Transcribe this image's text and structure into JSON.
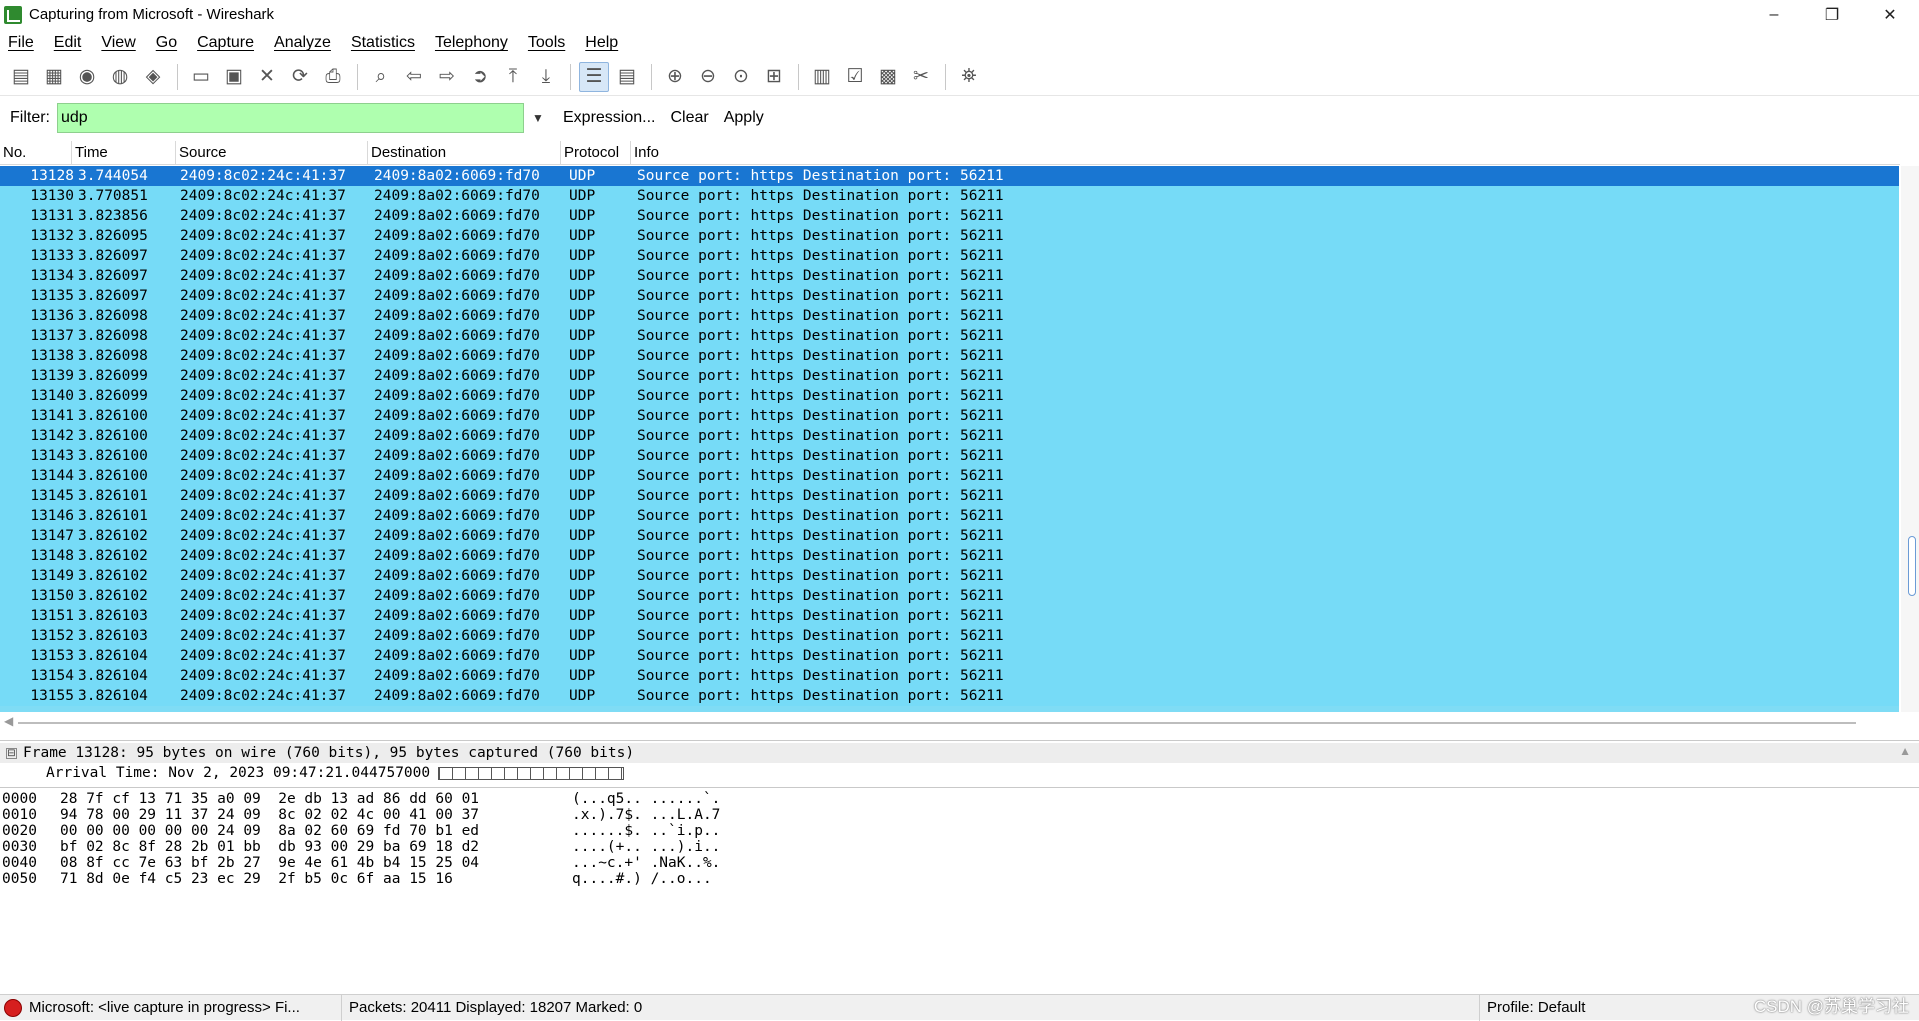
{
  "window": {
    "title": "Capturing from Microsoft - Wireshark",
    "minimize": "–",
    "restore": "❐",
    "close": "✕"
  },
  "menu": [
    "File",
    "Edit",
    "View",
    "Go",
    "Capture",
    "Analyze",
    "Statistics",
    "Telephony",
    "Tools",
    "Help"
  ],
  "toolbar": {
    "groups": [
      [
        "interfaces-icon",
        "options-icon",
        "start-icon",
        "stop-icon",
        "restart-icon"
      ],
      [
        "open-icon",
        "save-icon",
        "close-icon",
        "reload-icon",
        "print-icon"
      ],
      [
        "find-icon",
        "back-icon",
        "forward-icon",
        "goto-icon",
        "first-icon",
        "last-icon"
      ],
      [
        "colorize-icon",
        "autoscroll-icon"
      ],
      [
        "zoom-in-icon",
        "zoom-out-icon",
        "zoom-normal-icon",
        "resize-columns-icon"
      ],
      [
        "capture-filters-icon",
        "display-filters-icon",
        "coloring-rules-icon",
        "preferences-icon"
      ],
      [
        "help-icon"
      ]
    ],
    "glyphs": {
      "interfaces-icon": "▤",
      "options-icon": "▦",
      "start-icon": "◉",
      "stop-icon": "◍",
      "restart-icon": "◈",
      "open-icon": "▭",
      "save-icon": "▣",
      "close-icon": "✕",
      "reload-icon": "⟳",
      "print-icon": "⎙",
      "find-icon": "⌕",
      "back-icon": "⇦",
      "forward-icon": "⇨",
      "goto-icon": "➲",
      "first-icon": "⤒",
      "last-icon": "⤓",
      "colorize-icon": "☰",
      "autoscroll-icon": "▤",
      "zoom-in-icon": "⊕",
      "zoom-out-icon": "⊖",
      "zoom-normal-icon": "⊙",
      "resize-columns-icon": "⊞",
      "capture-filters-icon": "▥",
      "display-filters-icon": "☑",
      "coloring-rules-icon": "▩",
      "preferences-icon": "✂",
      "help-icon": "⛯"
    },
    "active": [
      "colorize-icon"
    ]
  },
  "filter": {
    "label": "Filter:",
    "value": "udp",
    "expression": "Expression...",
    "clear": "Clear",
    "apply": "Apply",
    "color": "#afffaf"
  },
  "packet_list": {
    "columns": [
      "No.",
      "Time",
      "Source",
      "Destination",
      "Protocol",
      "Info"
    ],
    "selected_no": "13128",
    "rows": [
      {
        "no": "13128",
        "time": "3.744054",
        "src": "2409:8c02:24c:41:37",
        "dst": "2409:8a02:6069:fd70",
        "proto": "UDP",
        "info": "Source port: https  Destination port: 56211"
      },
      {
        "no": "13130",
        "time": "3.770851",
        "src": "2409:8c02:24c:41:37",
        "dst": "2409:8a02:6069:fd70",
        "proto": "UDP",
        "info": "Source port: https  Destination port: 56211"
      },
      {
        "no": "13131",
        "time": "3.823856",
        "src": "2409:8c02:24c:41:37",
        "dst": "2409:8a02:6069:fd70",
        "proto": "UDP",
        "info": "Source port: https  Destination port: 56211"
      },
      {
        "no": "13132",
        "time": "3.826095",
        "src": "2409:8c02:24c:41:37",
        "dst": "2409:8a02:6069:fd70",
        "proto": "UDP",
        "info": "Source port: https  Destination port: 56211"
      },
      {
        "no": "13133",
        "time": "3.826097",
        "src": "2409:8c02:24c:41:37",
        "dst": "2409:8a02:6069:fd70",
        "proto": "UDP",
        "info": "Source port: https  Destination port: 56211"
      },
      {
        "no": "13134",
        "time": "3.826097",
        "src": "2409:8c02:24c:41:37",
        "dst": "2409:8a02:6069:fd70",
        "proto": "UDP",
        "info": "Source port: https  Destination port: 56211"
      },
      {
        "no": "13135",
        "time": "3.826097",
        "src": "2409:8c02:24c:41:37",
        "dst": "2409:8a02:6069:fd70",
        "proto": "UDP",
        "info": "Source port: https  Destination port: 56211"
      },
      {
        "no": "13136",
        "time": "3.826098",
        "src": "2409:8c02:24c:41:37",
        "dst": "2409:8a02:6069:fd70",
        "proto": "UDP",
        "info": "Source port: https  Destination port: 56211"
      },
      {
        "no": "13137",
        "time": "3.826098",
        "src": "2409:8c02:24c:41:37",
        "dst": "2409:8a02:6069:fd70",
        "proto": "UDP",
        "info": "Source port: https  Destination port: 56211"
      },
      {
        "no": "13138",
        "time": "3.826098",
        "src": "2409:8c02:24c:41:37",
        "dst": "2409:8a02:6069:fd70",
        "proto": "UDP",
        "info": "Source port: https  Destination port: 56211"
      },
      {
        "no": "13139",
        "time": "3.826099",
        "src": "2409:8c02:24c:41:37",
        "dst": "2409:8a02:6069:fd70",
        "proto": "UDP",
        "info": "Source port: https  Destination port: 56211"
      },
      {
        "no": "13140",
        "time": "3.826099",
        "src": "2409:8c02:24c:41:37",
        "dst": "2409:8a02:6069:fd70",
        "proto": "UDP",
        "info": "Source port: https  Destination port: 56211"
      },
      {
        "no": "13141",
        "time": "3.826100",
        "src": "2409:8c02:24c:41:37",
        "dst": "2409:8a02:6069:fd70",
        "proto": "UDP",
        "info": "Source port: https  Destination port: 56211"
      },
      {
        "no": "13142",
        "time": "3.826100",
        "src": "2409:8c02:24c:41:37",
        "dst": "2409:8a02:6069:fd70",
        "proto": "UDP",
        "info": "Source port: https  Destination port: 56211"
      },
      {
        "no": "13143",
        "time": "3.826100",
        "src": "2409:8c02:24c:41:37",
        "dst": "2409:8a02:6069:fd70",
        "proto": "UDP",
        "info": "Source port: https  Destination port: 56211"
      },
      {
        "no": "13144",
        "time": "3.826100",
        "src": "2409:8c02:24c:41:37",
        "dst": "2409:8a02:6069:fd70",
        "proto": "UDP",
        "info": "Source port: https  Destination port: 56211"
      },
      {
        "no": "13145",
        "time": "3.826101",
        "src": "2409:8c02:24c:41:37",
        "dst": "2409:8a02:6069:fd70",
        "proto": "UDP",
        "info": "Source port: https  Destination port: 56211"
      },
      {
        "no": "13146",
        "time": "3.826101",
        "src": "2409:8c02:24c:41:37",
        "dst": "2409:8a02:6069:fd70",
        "proto": "UDP",
        "info": "Source port: https  Destination port: 56211"
      },
      {
        "no": "13147",
        "time": "3.826102",
        "src": "2409:8c02:24c:41:37",
        "dst": "2409:8a02:6069:fd70",
        "proto": "UDP",
        "info": "Source port: https  Destination port: 56211"
      },
      {
        "no": "13148",
        "time": "3.826102",
        "src": "2409:8c02:24c:41:37",
        "dst": "2409:8a02:6069:fd70",
        "proto": "UDP",
        "info": "Source port: https  Destination port: 56211"
      },
      {
        "no": "13149",
        "time": "3.826102",
        "src": "2409:8c02:24c:41:37",
        "dst": "2409:8a02:6069:fd70",
        "proto": "UDP",
        "info": "Source port: https  Destination port: 56211"
      },
      {
        "no": "13150",
        "time": "3.826102",
        "src": "2409:8c02:24c:41:37",
        "dst": "2409:8a02:6069:fd70",
        "proto": "UDP",
        "info": "Source port: https  Destination port: 56211"
      },
      {
        "no": "13151",
        "time": "3.826103",
        "src": "2409:8c02:24c:41:37",
        "dst": "2409:8a02:6069:fd70",
        "proto": "UDP",
        "info": "Source port: https  Destination port: 56211"
      },
      {
        "no": "13152",
        "time": "3.826103",
        "src": "2409:8c02:24c:41:37",
        "dst": "2409:8a02:6069:fd70",
        "proto": "UDP",
        "info": "Source port: https  Destination port: 56211"
      },
      {
        "no": "13153",
        "time": "3.826104",
        "src": "2409:8c02:24c:41:37",
        "dst": "2409:8a02:6069:fd70",
        "proto": "UDP",
        "info": "Source port: https  Destination port: 56211"
      },
      {
        "no": "13154",
        "time": "3.826104",
        "src": "2409:8c02:24c:41:37",
        "dst": "2409:8a02:6069:fd70",
        "proto": "UDP",
        "info": "Source port: https  Destination port: 56211"
      },
      {
        "no": "13155",
        "time": "3.826104",
        "src": "2409:8c02:24c:41:37",
        "dst": "2409:8a02:6069:fd70",
        "proto": "UDP",
        "info": "Source port: https  Destination port: 56211"
      }
    ],
    "row_color": "#76dbf7",
    "selected_color": "#1976d2"
  },
  "details": {
    "frame_line": "Frame 13128: 95 bytes on wire (760 bits), 95 bytes captured (760 bits)",
    "arrival_line": "Arrival Time: Nov  2, 2023 09:47:21.044757000",
    "expander": "⊟"
  },
  "hex": {
    "rows": [
      {
        "offset": "0000",
        "bytes": "28 7f cf 13 71 35 a0 09  2e db 13 ad 86 dd 60 01",
        "ascii": "(...q5.. ......`."
      },
      {
        "offset": "0010",
        "bytes": "94 78 00 29 11 37 24 09  8c 02 02 4c 00 41 00 37",
        "ascii": ".x.).7$. ...L.A.7"
      },
      {
        "offset": "0020",
        "bytes": "00 00 00 00 00 00 24 09  8a 02 60 69 fd 70 b1 ed",
        "ascii": "......$. ..`i.p.."
      },
      {
        "offset": "0030",
        "bytes": "bf 02 8c 8f 28 2b 01 bb  db 93 00 29 ba 69 18 d2",
        "ascii": "....(+.. ...).i.."
      },
      {
        "offset": "0040",
        "bytes": "08 8f cc 7e 63 bf 2b 27  9e 4e 61 4b b4 15 25 04",
        "ascii": "...~c.+' .NaK..%."
      },
      {
        "offset": "0050",
        "bytes": "71 8d 0e f4 c5 23 ec 29  2f b5 0c 6f aa 15 16",
        "ascii": "q....#.) /..o..."
      }
    ]
  },
  "status": {
    "capture": "Microsoft: <live capture in progress> Fi...",
    "packets": "Packets: 20411 Displayed: 18207 Marked: 0",
    "profile": "Profile: Default",
    "watermark": "CSDN @苏巢学习社"
  }
}
